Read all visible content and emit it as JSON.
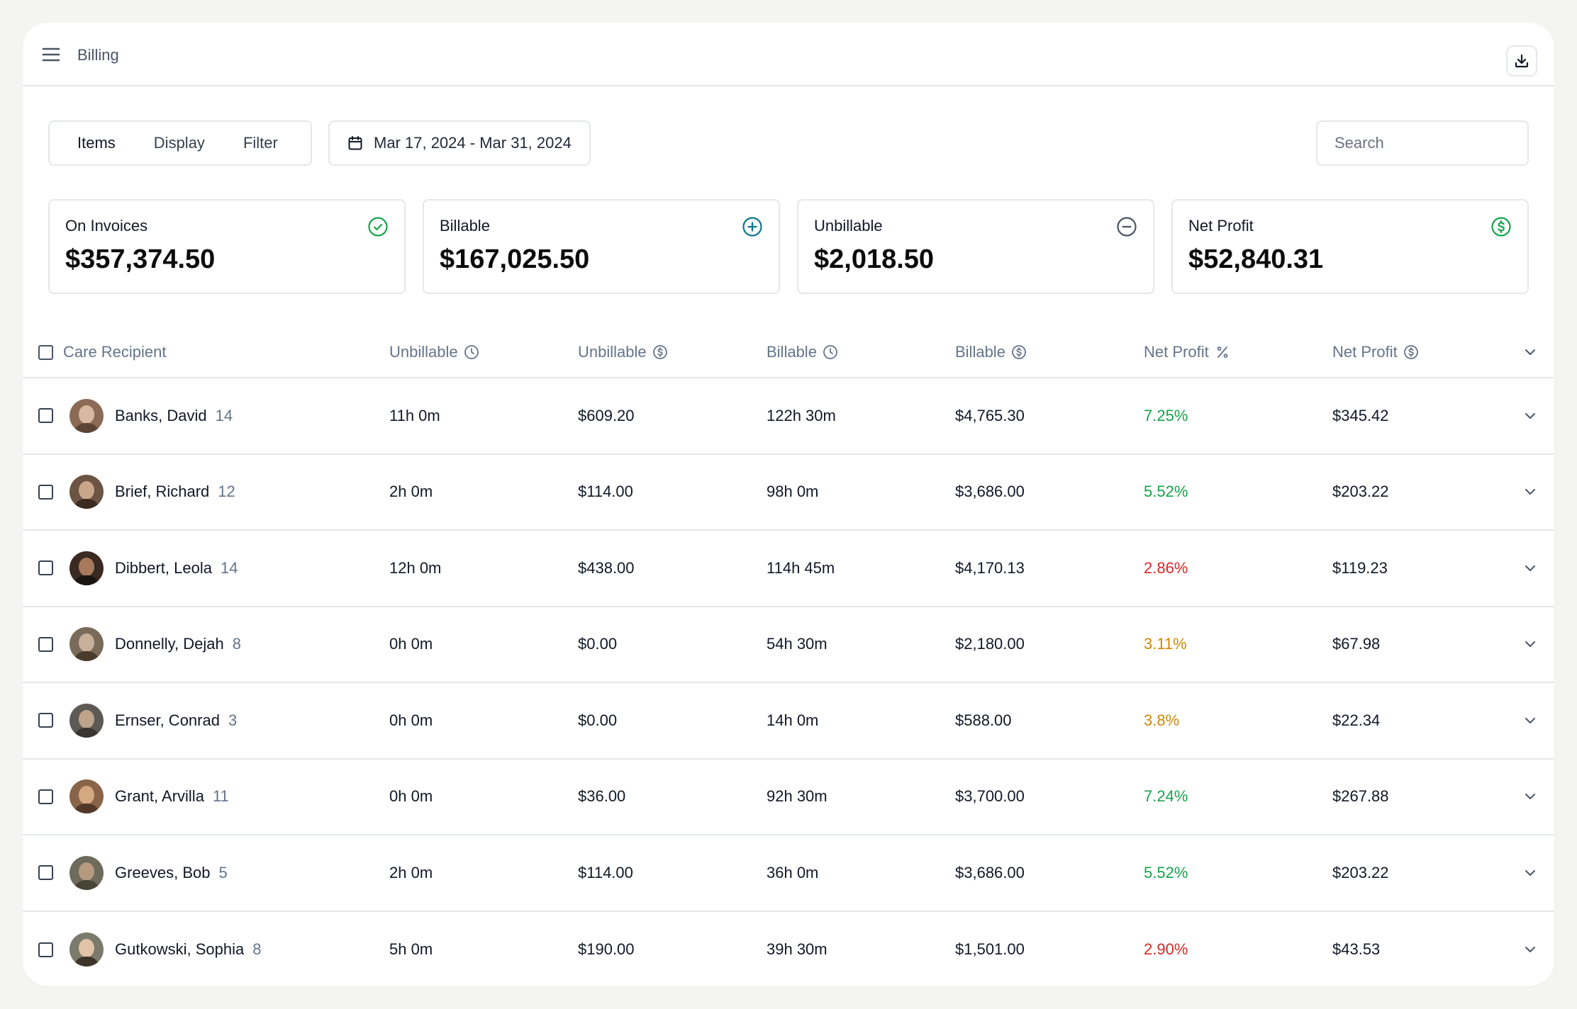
{
  "header": {
    "title": "Billing"
  },
  "toolbar": {
    "tabs": [
      {
        "label": "Items"
      },
      {
        "label": "Display"
      },
      {
        "label": "Filter"
      }
    ],
    "date_range": "Mar 17, 2024 - Mar 31, 2024",
    "search_placeholder": "Search"
  },
  "cards": [
    {
      "label": "On Invoices",
      "value": "$357,374.50",
      "icon": "check-circle-icon",
      "color": "#16a34a"
    },
    {
      "label": "Billable",
      "value": "$167,025.50",
      "icon": "plus-circle-icon",
      "color": "#0e7490"
    },
    {
      "label": "Unbillable",
      "value": "$2,018.50",
      "icon": "minus-circle-icon",
      "color": "#4b5563"
    },
    {
      "label": "Net Profit",
      "value": "$52,840.31",
      "icon": "dollar-circle-icon",
      "color": "#16a34a"
    }
  ],
  "table": {
    "columns": [
      {
        "label": "Care Recipient"
      },
      {
        "label": "Unbillable",
        "icon": "clock-icon"
      },
      {
        "label": "Unbillable",
        "icon": "dollar-circle-icon"
      },
      {
        "label": "Billable",
        "icon": "clock-icon"
      },
      {
        "label": "Billable",
        "icon": "dollar-circle-icon"
      },
      {
        "label": "Net Profit",
        "icon": "percent-icon"
      },
      {
        "label": "Net Profit",
        "icon": "dollar-circle-icon"
      }
    ],
    "rows": [
      {
        "name": "Banks, David",
        "count": "14",
        "unbillable_time": "11h 0m",
        "unbillable_amount": "$609.20",
        "billable_time": "122h 30m",
        "billable_amount": "$4,765.30",
        "net_profit_pct": "7.25%",
        "pct_status": "green",
        "net_profit": "$345.42"
      },
      {
        "name": "Brief, Richard",
        "count": "12",
        "unbillable_time": "2h 0m",
        "unbillable_amount": "$114.00",
        "billable_time": "98h 0m",
        "billable_amount": "$3,686.00",
        "net_profit_pct": "5.52%",
        "pct_status": "green",
        "net_profit": "$203.22"
      },
      {
        "name": "Dibbert, Leola",
        "count": "14",
        "unbillable_time": "12h 0m",
        "unbillable_amount": "$438.00",
        "billable_time": "114h 45m",
        "billable_amount": "$4,170.13",
        "net_profit_pct": "2.86%",
        "pct_status": "red",
        "net_profit": "$119.23"
      },
      {
        "name": "Donnelly, Dejah",
        "count": "8",
        "unbillable_time": "0h 0m",
        "unbillable_amount": "$0.00",
        "billable_time": "54h 30m",
        "billable_amount": "$2,180.00",
        "net_profit_pct": "3.11%",
        "pct_status": "orange",
        "net_profit": "$67.98"
      },
      {
        "name": "Ernser, Conrad",
        "count": "3",
        "unbillable_time": "0h 0m",
        "unbillable_amount": "$0.00",
        "billable_time": "14h 0m",
        "billable_amount": "$588.00",
        "net_profit_pct": "3.8%",
        "pct_status": "orange",
        "net_profit": "$22.34"
      },
      {
        "name": "Grant, Arvilla",
        "count": "11",
        "unbillable_time": "0h 0m",
        "unbillable_amount": "$36.00",
        "billable_time": "92h 30m",
        "billable_amount": "$3,700.00",
        "net_profit_pct": "7.24%",
        "pct_status": "green",
        "net_profit": "$267.88"
      },
      {
        "name": "Greeves, Bob",
        "count": "5",
        "unbillable_time": "2h 0m",
        "unbillable_amount": "$114.00",
        "billable_time": "36h 0m",
        "billable_amount": "$3,686.00",
        "net_profit_pct": "5.52%",
        "pct_status": "green",
        "net_profit": "$203.22"
      },
      {
        "name": "Gutkowski, Sophia",
        "count": "8",
        "unbillable_time": "5h 0m",
        "unbillable_amount": "$190.00",
        "billable_time": "39h 30m",
        "billable_amount": "$1,501.00",
        "net_profit_pct": "2.90%",
        "pct_status": "red",
        "net_profit": "$43.53"
      }
    ]
  },
  "colors": {
    "positive": "#16a34a",
    "negative": "#dc2626",
    "warning": "#d08700",
    "border": "#e5e7eb"
  }
}
